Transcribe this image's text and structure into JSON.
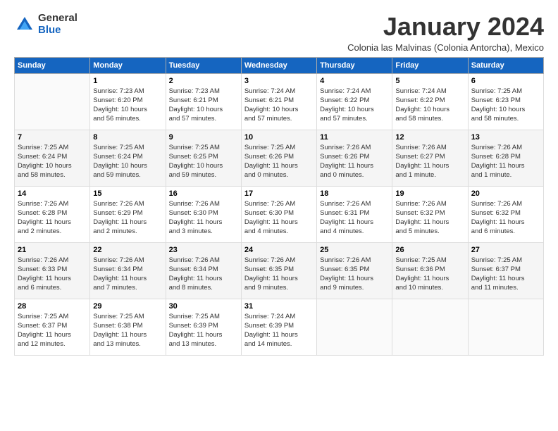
{
  "logo": {
    "general": "General",
    "blue": "Blue"
  },
  "title": "January 2024",
  "subtitle": "Colonia las Malvinas (Colonia Antorcha), Mexico",
  "weekdays": [
    "Sunday",
    "Monday",
    "Tuesday",
    "Wednesday",
    "Thursday",
    "Friday",
    "Saturday"
  ],
  "weeks": [
    [
      {
        "num": "",
        "info": ""
      },
      {
        "num": "1",
        "info": "Sunrise: 7:23 AM\nSunset: 6:20 PM\nDaylight: 10 hours\nand 56 minutes."
      },
      {
        "num": "2",
        "info": "Sunrise: 7:23 AM\nSunset: 6:21 PM\nDaylight: 10 hours\nand 57 minutes."
      },
      {
        "num": "3",
        "info": "Sunrise: 7:24 AM\nSunset: 6:21 PM\nDaylight: 10 hours\nand 57 minutes."
      },
      {
        "num": "4",
        "info": "Sunrise: 7:24 AM\nSunset: 6:22 PM\nDaylight: 10 hours\nand 57 minutes."
      },
      {
        "num": "5",
        "info": "Sunrise: 7:24 AM\nSunset: 6:22 PM\nDaylight: 10 hours\nand 58 minutes."
      },
      {
        "num": "6",
        "info": "Sunrise: 7:25 AM\nSunset: 6:23 PM\nDaylight: 10 hours\nand 58 minutes."
      }
    ],
    [
      {
        "num": "7",
        "info": "Sunrise: 7:25 AM\nSunset: 6:24 PM\nDaylight: 10 hours\nand 58 minutes."
      },
      {
        "num": "8",
        "info": "Sunrise: 7:25 AM\nSunset: 6:24 PM\nDaylight: 10 hours\nand 59 minutes."
      },
      {
        "num": "9",
        "info": "Sunrise: 7:25 AM\nSunset: 6:25 PM\nDaylight: 10 hours\nand 59 minutes."
      },
      {
        "num": "10",
        "info": "Sunrise: 7:25 AM\nSunset: 6:26 PM\nDaylight: 11 hours\nand 0 minutes."
      },
      {
        "num": "11",
        "info": "Sunrise: 7:26 AM\nSunset: 6:26 PM\nDaylight: 11 hours\nand 0 minutes."
      },
      {
        "num": "12",
        "info": "Sunrise: 7:26 AM\nSunset: 6:27 PM\nDaylight: 11 hours\nand 1 minute."
      },
      {
        "num": "13",
        "info": "Sunrise: 7:26 AM\nSunset: 6:28 PM\nDaylight: 11 hours\nand 1 minute."
      }
    ],
    [
      {
        "num": "14",
        "info": "Sunrise: 7:26 AM\nSunset: 6:28 PM\nDaylight: 11 hours\nand 2 minutes."
      },
      {
        "num": "15",
        "info": "Sunrise: 7:26 AM\nSunset: 6:29 PM\nDaylight: 11 hours\nand 2 minutes."
      },
      {
        "num": "16",
        "info": "Sunrise: 7:26 AM\nSunset: 6:30 PM\nDaylight: 11 hours\nand 3 minutes."
      },
      {
        "num": "17",
        "info": "Sunrise: 7:26 AM\nSunset: 6:30 PM\nDaylight: 11 hours\nand 4 minutes."
      },
      {
        "num": "18",
        "info": "Sunrise: 7:26 AM\nSunset: 6:31 PM\nDaylight: 11 hours\nand 4 minutes."
      },
      {
        "num": "19",
        "info": "Sunrise: 7:26 AM\nSunset: 6:32 PM\nDaylight: 11 hours\nand 5 minutes."
      },
      {
        "num": "20",
        "info": "Sunrise: 7:26 AM\nSunset: 6:32 PM\nDaylight: 11 hours\nand 6 minutes."
      }
    ],
    [
      {
        "num": "21",
        "info": "Sunrise: 7:26 AM\nSunset: 6:33 PM\nDaylight: 11 hours\nand 6 minutes."
      },
      {
        "num": "22",
        "info": "Sunrise: 7:26 AM\nSunset: 6:34 PM\nDaylight: 11 hours\nand 7 minutes."
      },
      {
        "num": "23",
        "info": "Sunrise: 7:26 AM\nSunset: 6:34 PM\nDaylight: 11 hours\nand 8 minutes."
      },
      {
        "num": "24",
        "info": "Sunrise: 7:26 AM\nSunset: 6:35 PM\nDaylight: 11 hours\nand 9 minutes."
      },
      {
        "num": "25",
        "info": "Sunrise: 7:26 AM\nSunset: 6:35 PM\nDaylight: 11 hours\nand 9 minutes."
      },
      {
        "num": "26",
        "info": "Sunrise: 7:25 AM\nSunset: 6:36 PM\nDaylight: 11 hours\nand 10 minutes."
      },
      {
        "num": "27",
        "info": "Sunrise: 7:25 AM\nSunset: 6:37 PM\nDaylight: 11 hours\nand 11 minutes."
      }
    ],
    [
      {
        "num": "28",
        "info": "Sunrise: 7:25 AM\nSunset: 6:37 PM\nDaylight: 11 hours\nand 12 minutes."
      },
      {
        "num": "29",
        "info": "Sunrise: 7:25 AM\nSunset: 6:38 PM\nDaylight: 11 hours\nand 13 minutes."
      },
      {
        "num": "30",
        "info": "Sunrise: 7:25 AM\nSunset: 6:39 PM\nDaylight: 11 hours\nand 13 minutes."
      },
      {
        "num": "31",
        "info": "Sunrise: 7:24 AM\nSunset: 6:39 PM\nDaylight: 11 hours\nand 14 minutes."
      },
      {
        "num": "",
        "info": ""
      },
      {
        "num": "",
        "info": ""
      },
      {
        "num": "",
        "info": ""
      }
    ]
  ]
}
